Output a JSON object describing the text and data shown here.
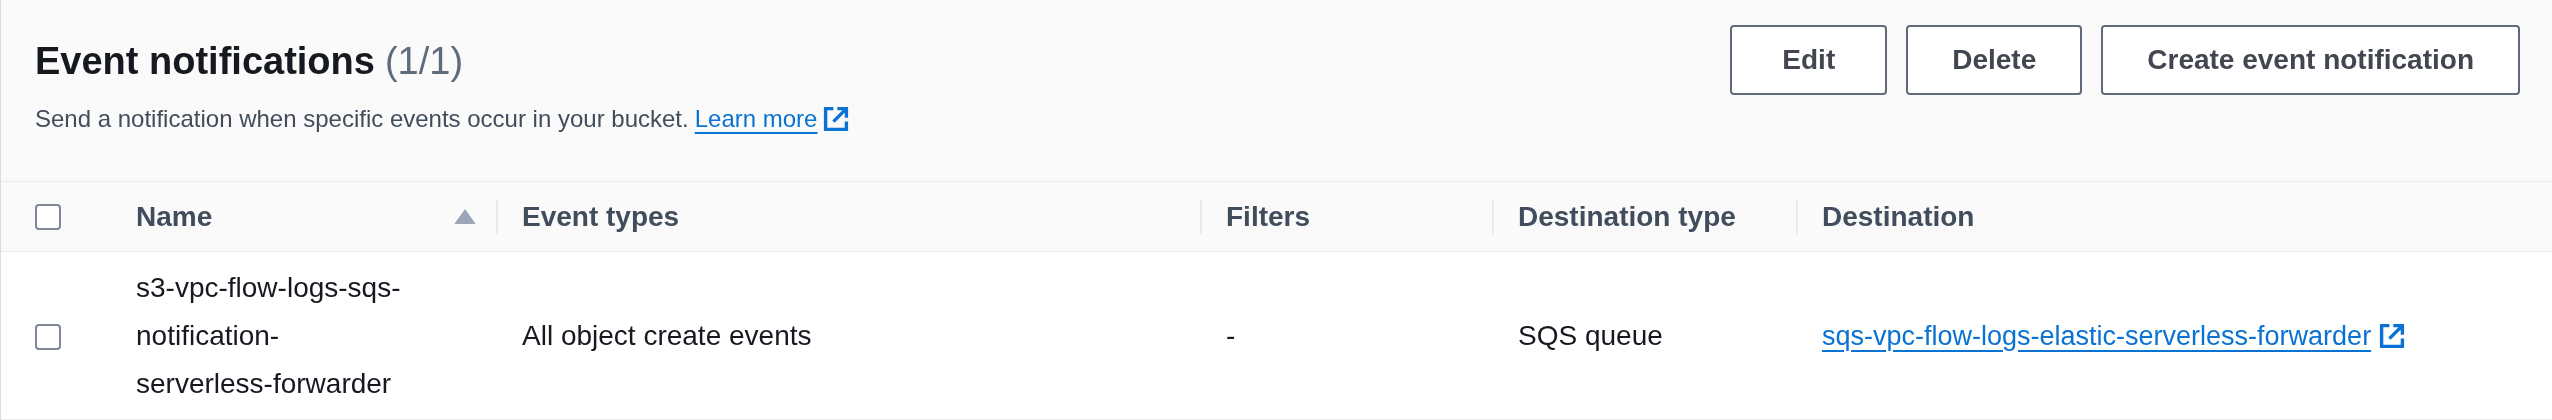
{
  "header": {
    "title": "Event notifications",
    "count": "(1/1)",
    "description": "Send a notification when specific events occur in your bucket.",
    "learn_more": "Learn more"
  },
  "buttons": [
    {
      "label": "Edit"
    },
    {
      "label": "Delete"
    },
    {
      "label": "Create event notification"
    }
  ],
  "table": {
    "select_all": {
      "checked": false
    },
    "columns": [
      {
        "label": "Name",
        "sorted": true
      },
      {
        "label": "Event types",
        "sorted": false
      },
      {
        "label": "Filters",
        "sorted": false
      },
      {
        "label": "Destination type",
        "sorted": false
      },
      {
        "label": "Destination",
        "sorted": false
      }
    ],
    "rows": [
      {
        "checked": false,
        "name": "s3-vpc-flow-logs-sqs-notification-serverless-forwarder",
        "event_types": "All object create events",
        "filters": "-",
        "destination_type": "SQS queue",
        "destination": "sqs-vpc-flow-logs-elastic-serverless-forwarder"
      }
    ]
  }
}
